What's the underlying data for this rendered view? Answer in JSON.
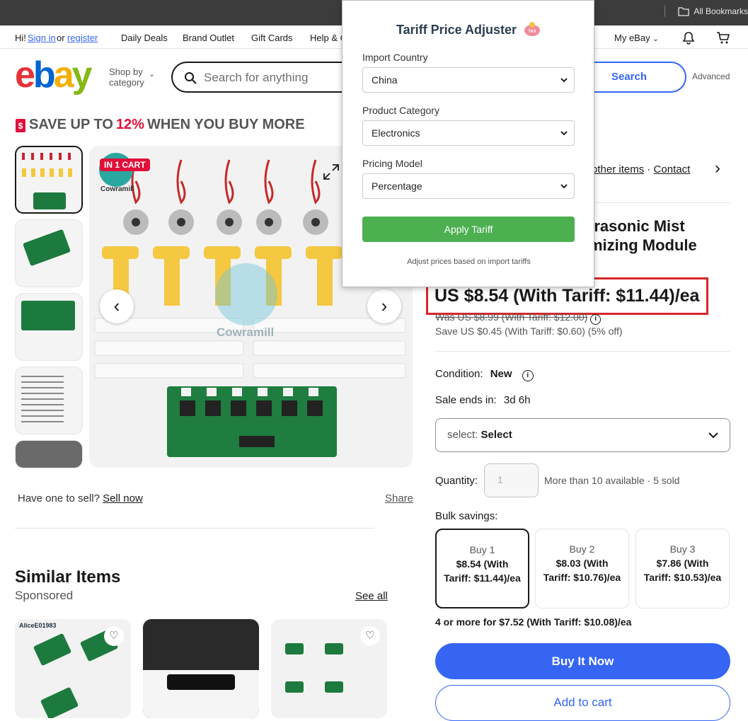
{
  "browser": {
    "bookmarks_label": "All Bookmarks"
  },
  "topnav": {
    "greeting": "Hi!",
    "sign_in": "Sign in",
    "or": "or",
    "register": "register",
    "links": [
      "Daily Deals",
      "Brand Outlet",
      "Gift Cards",
      "Help & C"
    ],
    "my_ebay": "My eBay"
  },
  "header": {
    "shop_by_line1": "Shop by",
    "shop_by_line2": "category",
    "search_placeholder": "Search for anything",
    "search_button": "Search",
    "advanced": "Advanced"
  },
  "banner": {
    "prefix": "SAVE UP TO",
    "percent": "12%",
    "suffix": "WHEN YOU BUY MORE"
  },
  "gallery": {
    "in_cart_badge": "IN 1 CART",
    "watermark": "Cowramill",
    "brand_small": "Cowramill"
  },
  "sell": {
    "have_one": "Have one to sell?",
    "sell_now": "Sell now",
    "share": "Share"
  },
  "seller": {
    "other_items": "other items",
    "contact": "Contact"
  },
  "product": {
    "title_line1": "trasonic Mist",
    "title_line2": "mizing Module",
    "price": "US $8.54 (With Tariff: $11.44)/ea",
    "was_price": "Was US $8.99 (With Tariff: $12.00)",
    "save_text": "Save US $0.45 (With Tariff: $0.60) (5% off)",
    "condition_label": "Condition:",
    "condition_value": "New",
    "sale_label": "Sale ends in:",
    "sale_value": "3d 6h",
    "select_label": "select:",
    "select_value": "Select",
    "quantity_label": "Quantity:",
    "quantity_value": "1",
    "availability": "More than 10 available",
    "sold": "5 sold",
    "bulk_label": "Bulk savings:",
    "bulk": [
      {
        "title": "Buy 1",
        "price": "$8.54 (With Tariff: $11.44)/ea"
      },
      {
        "title": "Buy 2",
        "price": "$8.03 (With Tariff: $10.76)/ea"
      },
      {
        "title": "Buy 3",
        "price": "$7.86 (With Tariff: $10.53)/ea"
      }
    ],
    "bulk_more": "4 or more for $7.52 (With Tariff: $10.08)/ea",
    "buy_now": "Buy It Now",
    "add_to_cart": "Add to cart"
  },
  "similar": {
    "title": "Similar Items",
    "sponsored": "Sponsored",
    "see_all": "See all",
    "card1_label": "AliceE01983"
  },
  "popup": {
    "title": "Tariff Price Adjuster",
    "country_label": "Import Country",
    "country_value": "China",
    "category_label": "Product Category",
    "category_value": "Electronics",
    "model_label": "Pricing Model",
    "model_value": "Percentage",
    "apply": "Apply Tariff",
    "hint": "Adjust prices based on import tariffs",
    "icon_text": "TAX"
  },
  "colors": {
    "ebay_blue": "#3665f3",
    "tariff_red": "#d9262c",
    "apply_green": "#4caf50"
  }
}
